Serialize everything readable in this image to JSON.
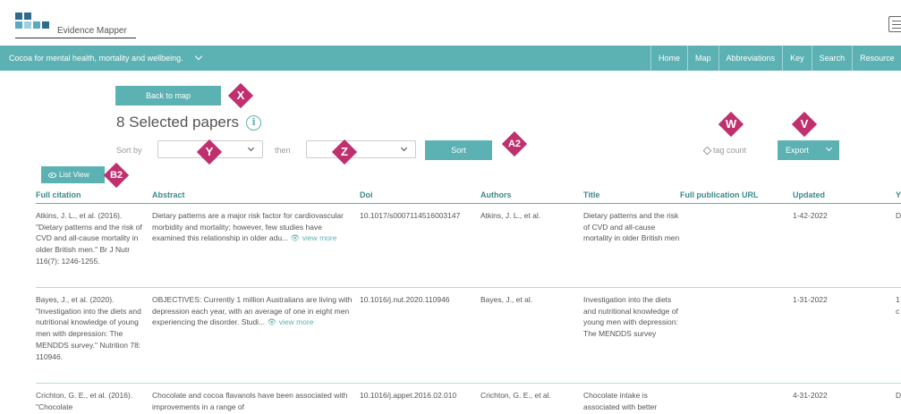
{
  "header": {
    "app_name": "Evidence Mapper",
    "logo_colors": [
      "#2e6c8c",
      "#5aa9bf",
      "#9ed0dd"
    ]
  },
  "navbar": {
    "title": "Cocoa for mental health, mortality and wellbeing.",
    "links": [
      "Home",
      "Map",
      "Abbreviations",
      "Key",
      "Search",
      "Resource"
    ]
  },
  "controls": {
    "back_button": "Back to map",
    "heading": "8 Selected papers",
    "sort_by_label": "Sort by",
    "then_label": "then",
    "sort_select_1": "",
    "sort_select_2": "",
    "sort_button": "Sort",
    "tag_count_label": "tag count",
    "export_button": "Export",
    "list_view_button": "List View"
  },
  "markers": {
    "x": "X",
    "y": "Y",
    "z": "Z",
    "a2": "A2",
    "w": "W",
    "v": "V",
    "b2": "B2"
  },
  "table": {
    "columns": [
      "Full citation",
      "Abstract",
      "Doi",
      "Authors",
      "Title",
      "Full publication URL",
      "Updated",
      "Y"
    ],
    "view_more_label": "view more",
    "rows": [
      {
        "citation": "Atkins, J. L., et al. (2016). \"Dietary patterns and the risk of CVD and all-cause mortality in older British men.\" Br J Nutr 116(7): 1246-1255.",
        "abstract": "Dietary patterns are a major risk factor for cardiovascular morbidity and mortality; however, few studies have examined this relationship in older adu...",
        "doi": "10.1017/s0007114516003147",
        "authors": "Atkins, J. L., et al.",
        "title": "Dietary patterns and the risk of CVD and all-cause mortality in older British men",
        "url": "",
        "updated": "1-42-2022",
        "extra": "D"
      },
      {
        "citation": "Bayes, J., et al. (2020). \"Investigation into the diets and nutritional knowledge of young men with depression: The MENDDS survey.\" Nutrition 78: 110946.",
        "abstract": "OBJECTIVES: Currently 1 million Australians are living with depression each year, with an average of one in eight men experiencing the disorder. Studi...",
        "doi": "10.1016/j.nut.2020.110946",
        "authors": "Bayes, J., et al.",
        "title": "Investigation into the diets and nutritional knowledge of young men with depression: The MENDDS survey",
        "url": "",
        "updated": "1-31-2022",
        "extra": "1 c"
      },
      {
        "citation": "Crichton, G. E., et al. (2016). \"Chocolate",
        "abstract": "Chocolate and cocoa flavanols have been associated with improvements in a range of",
        "doi": "10.1016/j.appet.2016.02.010",
        "authors": "Crichton, G. E., et al.",
        "title": "Chocolate intake is associated with better",
        "url": "",
        "updated": "4-31-2022",
        "extra": "D"
      }
    ]
  }
}
